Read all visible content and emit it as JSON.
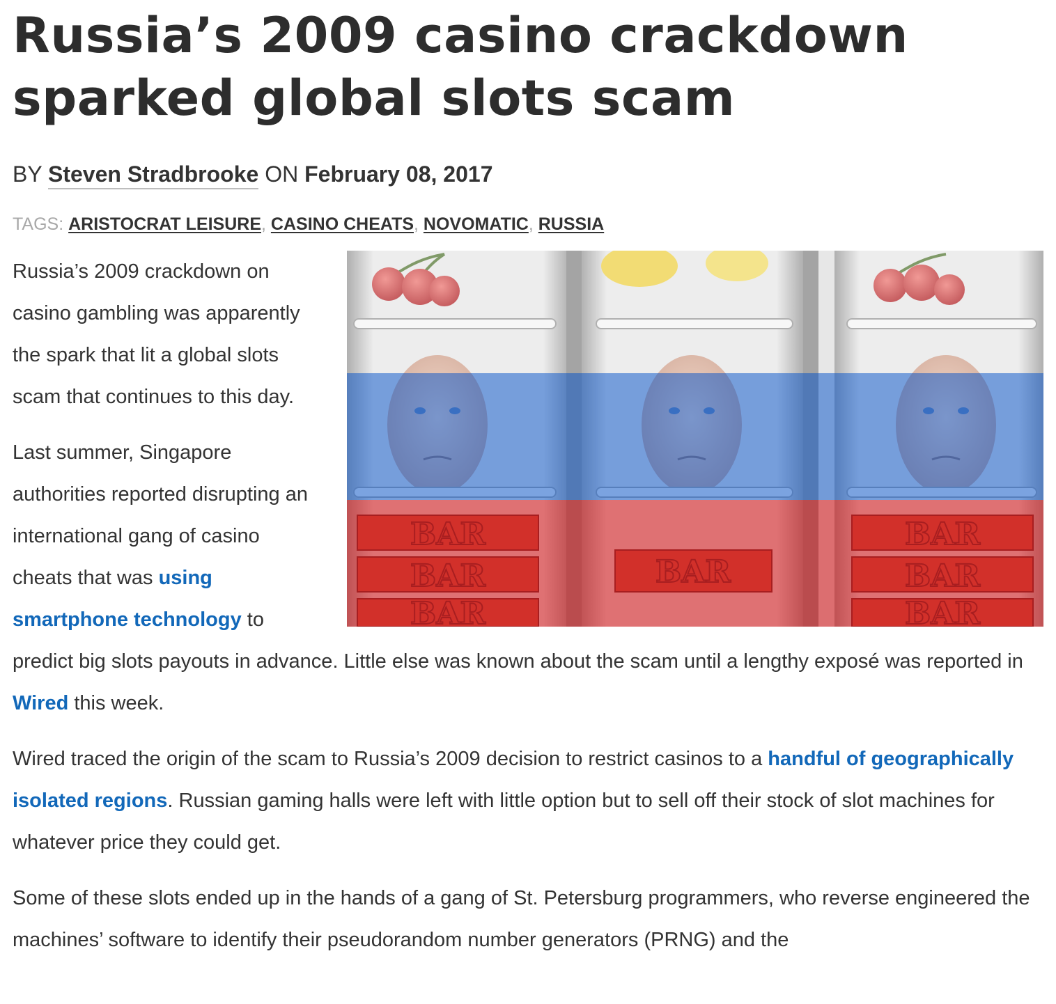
{
  "article": {
    "title": "Russia’s 2009 casino crackdown sparked global slots scam",
    "byline": {
      "by": "BY",
      "author": "Steven Stradbrooke",
      "on": "ON",
      "date": "February 08, 2017"
    },
    "tags": {
      "label": "TAGS:",
      "items": [
        "ARISTOCRAT LEISURE",
        "CASINO CHEATS",
        "NOVOMATIC",
        "RUSSIA"
      ],
      "separator": ","
    },
    "hero": {
      "reel_label": "BAR",
      "colors": {
        "white": "#f2f2f2",
        "blue": "#2e6fd2",
        "red": "#d8262a"
      }
    },
    "paragraphs": {
      "p1": "Russia’s 2009 crackdown on casino gambling was apparently the spark that lit a global slots scam that continues to this day.",
      "p2_before": "Last summer, Singapore authorities reported disrupting an international gang of casino cheats that was ",
      "p2_link1": "using smartphone technology",
      "p2_mid": " to predict big slots payouts in advance. Little else was known about the scam until a lengthy exposé was reported in ",
      "p2_link2": "Wired",
      "p2_after": " this week.",
      "p3_before": "Wired traced the origin of the scam to Russia’s 2009 decision to restrict casinos to a ",
      "p3_link": "handful of geographically isolated regions",
      "p3_after": ". Russian gaming halls were left with little option but to sell off their stock of slot machines for whatever price they could get.",
      "p4": "Some of these slots ended up in the hands of a gang of St. Petersburg programmers, who reverse engineered the machines’ software to identify their pseudorandom number generators (PRNG) and the"
    },
    "link_color": "#1268b9"
  }
}
